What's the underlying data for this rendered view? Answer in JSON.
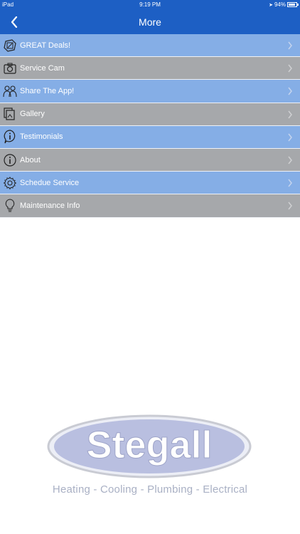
{
  "status": {
    "carrier": "iPad",
    "time": "9:19 PM",
    "battery": "94%",
    "battery_level": 0.94
  },
  "nav": {
    "title": "More"
  },
  "menu": [
    {
      "label": "GREAT Deals!",
      "icon": "deals-icon",
      "shade": "blue"
    },
    {
      "label": "Service Cam",
      "icon": "camera-icon",
      "shade": "gray"
    },
    {
      "label": "Share The App!",
      "icon": "share-people-icon",
      "shade": "blue"
    },
    {
      "label": "Gallery",
      "icon": "gallery-icon",
      "shade": "gray"
    },
    {
      "label": "Testimonials",
      "icon": "info-bubble-icon",
      "shade": "blue"
    },
    {
      "label": "About",
      "icon": "info-icon",
      "shade": "gray"
    },
    {
      "label": "Schedue Service",
      "icon": "gear-icon",
      "shade": "blue"
    },
    {
      "label": "Maintenance Info",
      "icon": "lightbulb-icon",
      "shade": "gray"
    }
  ],
  "brand": {
    "name": "Stegall",
    "tagline": "Heating - Cooling - Plumbing - Electrical"
  },
  "colors": {
    "nav": "#1d5fc4",
    "row_blue": "#85aee6",
    "row_gray": "#a6a8ab",
    "logo": "#b9bfe0"
  }
}
